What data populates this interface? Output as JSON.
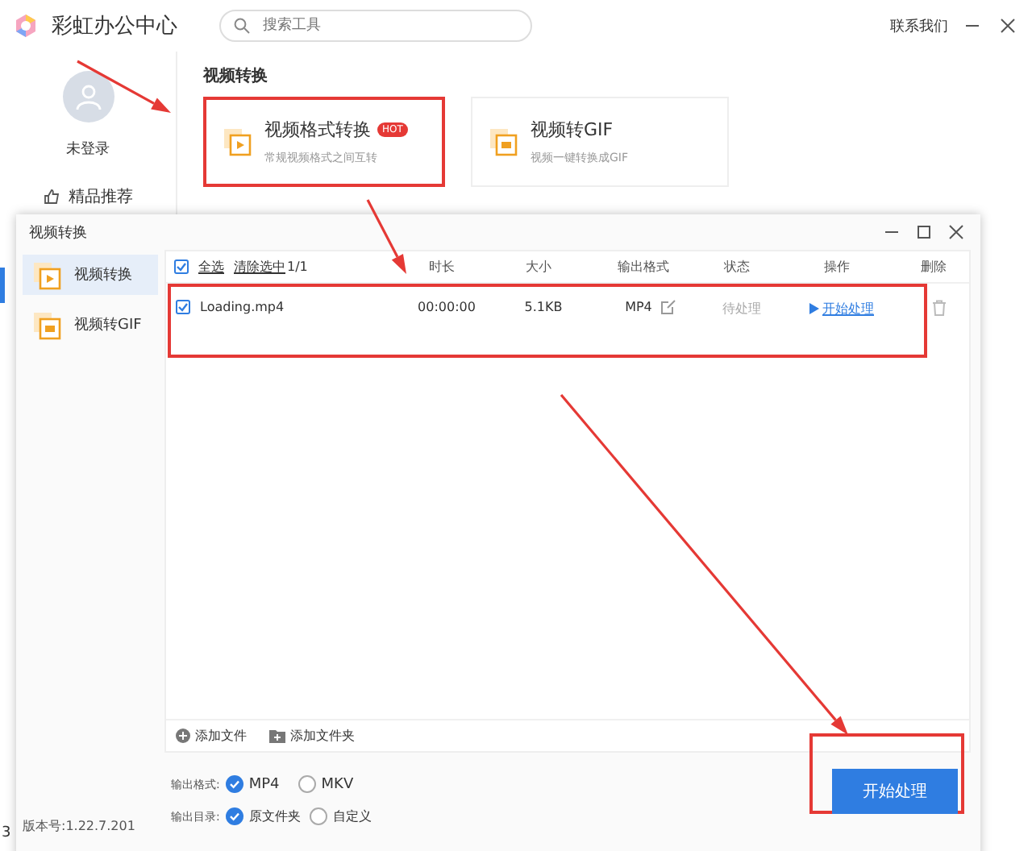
{
  "app": {
    "title": "彩虹办公中心",
    "search": {
      "placeholder": "搜索工具"
    },
    "contact": "联系我们",
    "user": "未登录",
    "nav": [
      {
        "label": "精品推荐",
        "selected": false
      }
    ],
    "section": "视频转换",
    "tools": [
      {
        "name": "视频格式转换",
        "badge": "HOT",
        "desc": "常规视频格式之间互转",
        "highlighted": true
      },
      {
        "name": "视频转GIF",
        "desc": "视频一键转换成GIF",
        "highlighted": false
      }
    ],
    "cut_text": "3"
  },
  "dialog": {
    "title": "视频转换",
    "tabs": [
      {
        "label": "视频转换",
        "selected": true
      },
      {
        "label": "视频转GIF",
        "selected": false
      }
    ],
    "version": "版本号:1.22.7.201",
    "select_all": {
      "label": "全选",
      "checked": true
    },
    "clear": "清除选中",
    "count": "1/1",
    "columns": [
      "时长",
      "大小",
      "输出格式",
      "状态",
      "操作",
      "删除"
    ],
    "rows": [
      {
        "name": "Loading.mp4",
        "checked": true,
        "duration": "00:00:00",
        "size": "5.1KB",
        "format": "MP4",
        "status": "待处理",
        "action": "开始处理",
        "highlighted": true
      }
    ],
    "add_file": "添加文件",
    "add_folder": "添加文件夹",
    "format_label": "输出格式:",
    "formats": [
      {
        "label": "MP4",
        "selected": true
      },
      {
        "label": "MKV",
        "selected": false
      }
    ],
    "dir_label": "输出目录:",
    "dirs": [
      {
        "label": "原文件夹",
        "selected": true
      },
      {
        "label": "自定义",
        "selected": false
      }
    ],
    "start": {
      "label": "开始处理",
      "highlighted": true
    }
  }
}
